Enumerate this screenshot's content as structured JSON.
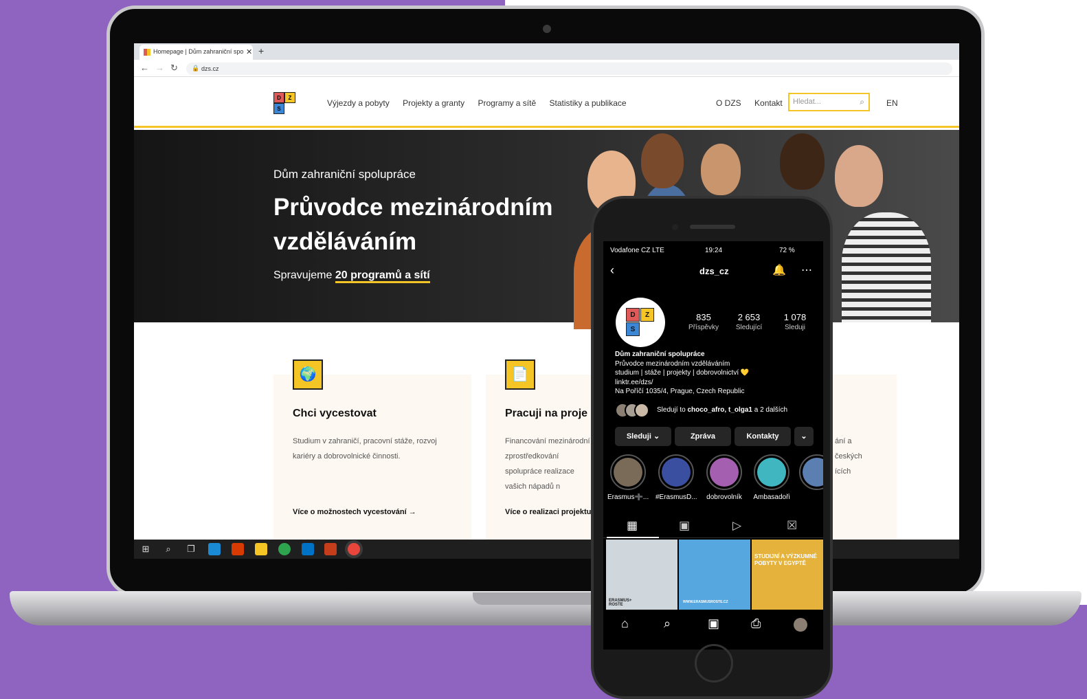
{
  "browser": {
    "tab_title": "Homepage | Dům zahraniční spo",
    "tab_close": "✕",
    "new_tab": "+",
    "url": "dzs.cz"
  },
  "site": {
    "logo_letters": [
      "D",
      "Z",
      "S"
    ],
    "nav": [
      "Výjezdy a pobyty",
      "Projekty a granty",
      "Programy a sítě",
      "Statistiky a publikace"
    ],
    "nav_right": [
      "O DZS",
      "Kontakt"
    ],
    "search_placeholder": "Hledat...",
    "lang": "EN",
    "hero": {
      "subtitle": "Dům zahraniční spolupráce",
      "title": "Průvodce mezinárodním vzděláváním",
      "tagline_prefix": "Spravujeme ",
      "tagline_link": "20 programů a sítí"
    },
    "cards": [
      {
        "title": "Chci vycestovat",
        "text": "Studium v zahraničí, pracovní stáže, rozvoj kariéry a dobrovolnické činnosti.",
        "link": "Více o možnostech vycestování →"
      },
      {
        "title": "Pracuji na proje",
        "text": "Financování mezinárodní zprostředkování spolupráce realizace vašich nápadů n",
        "link": "Více o realizaci projektu"
      },
      {
        "text": "ání a českých ících"
      }
    ]
  },
  "taskbar": {
    "icons": [
      "windows-start",
      "search",
      "task-view",
      "edge",
      "office",
      "file-explorer",
      "chrome",
      "outlook",
      "powerpoint",
      "chrome-active"
    ]
  },
  "phone": {
    "status": {
      "carrier": "Vodafone CZ  LTE",
      "time": "19:24",
      "battery": "72 %"
    },
    "username": "dzs_cz",
    "stats": [
      {
        "value": "835",
        "label": "Příspěvky"
      },
      {
        "value": "2 653",
        "label": "Sledující"
      },
      {
        "value": "1 078",
        "label": "Sleduji"
      }
    ],
    "bio": {
      "name": "Dům zahraniční spolupráce",
      "line1": "Průvodce mezinárodním vzděláváním",
      "line2": "studium | stáže | projekty | dobrovolnictví 💛",
      "link": "linktr.ee/dzs/",
      "address": "Na Poříčí 1035/4, Prague, Czech Republic"
    },
    "followed_by": {
      "prefix": "Sledují to ",
      "names": "choco_afro, t_olga1",
      "suffix": " a 2 dalších"
    },
    "buttons": [
      "Sleduji ⌄",
      "Zpráva",
      "Kontakty",
      "⌄"
    ],
    "highlights": [
      {
        "label": "Erasmus➕...",
        "color": "#7a6a58"
      },
      {
        "label": "#ErasmusD...",
        "color": "#3b4fa0"
      },
      {
        "label": "dobrovolník",
        "color": "#a55fb0"
      },
      {
        "label": "Ambasadoři",
        "color": "#3fb6c0"
      },
      {
        "label": "",
        "color": "#5a7fb0"
      }
    ],
    "posts": [
      {
        "text": "ERASMUS+ ROSTE",
        "color": "#cfd6dc"
      },
      {
        "text": "WWW.ERASMUSROSTE.CZ",
        "color": "#56a7e0"
      },
      {
        "text": "STUDIJNÍ A VÝZKUMNÉ POBYTY V EGYPTĚ",
        "color": "#e5b23c"
      }
    ]
  },
  "colors": {
    "accent": "#f4c524",
    "purple_bg": "#8f64c0",
    "card_bg": "#fdf8f1"
  }
}
